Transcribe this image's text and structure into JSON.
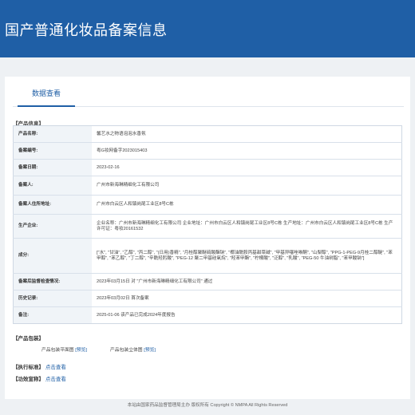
{
  "header": {
    "title": "国产普通化妆品备案信息"
  },
  "tabs": [
    {
      "label": "数据查看"
    }
  ],
  "product_info": {
    "section_title": "【产品信息】",
    "rows": [
      {
        "label": "产品名称:",
        "value": "馨艺水之物语泡泡水香氛"
      },
      {
        "label": "备案编号:",
        "value": "粤G妆网备字2023015403"
      },
      {
        "label": "备案日期:",
        "value": "2023-02-16"
      },
      {
        "label": "备案人:",
        "value": "广州市新海琳精细化工有限公司"
      },
      {
        "label": "备案人住所地址:",
        "value": "广州市白云区人和镇岗尾工业区8号C栋"
      },
      {
        "label": "生产企业:",
        "value": "企业名称：广州市新海琳精细化工有限公司 企业地址：广州市白云区人和镇岗尾工业区8号C栋 生产地址：广州市白云区人和镇岗尾工业区8号C栋 生产许可证：粤妆20161532"
      },
      {
        "label": "成分:",
        "value": "[\"水\", \"甘油\", \"乙醇\", \"丙二醇\", \"(日用)香精\", \"月桂醇聚醚硫酸酯钠\", \"椰油酰胺丙基甜菜碱\", \"甲基异噻唑啉酮\", \"山梨醇\", \"PPG-1-PEG-9月桂二醇醚\", \"苯甲醇\", \"苯乙醇\", \"丁二醇\", \"辛酰羟肟酸\", \"PEG-12 聚二甲基硅氧烷\", \"羟苯甲酯\", \"柠檬酸\", \"泛醇\", \"乳酸\", \"PEG-50 牛油树脂\", \"苯甲酸钠\"]"
      },
      {
        "label": "备案后监督检查情况:",
        "value": "2023年03月15日 对 \"广州市新海琳精细化工有限公司\" 通过"
      },
      {
        "label": "历史记录:",
        "value": "2023年03月02日 首次备案"
      },
      {
        "label": "备注:",
        "value": "2025-01-06 该产品已完成2024年度报告"
      }
    ]
  },
  "packaging": {
    "section_title": "【产品包装】",
    "flat_label": "产品包装平面图",
    "stereo_label": "产品包装立体图",
    "preview_link": "[预览]"
  },
  "standard": {
    "section_title": "【执行标准】",
    "link": "点击查看"
  },
  "efficacy": {
    "section_title": "【功效宣称】",
    "link": "点击查看"
  },
  "footer": {
    "text": "本站由国家药品监督管理局主办 版权所有 Copyright © NMPA All Rights Reserved"
  }
}
